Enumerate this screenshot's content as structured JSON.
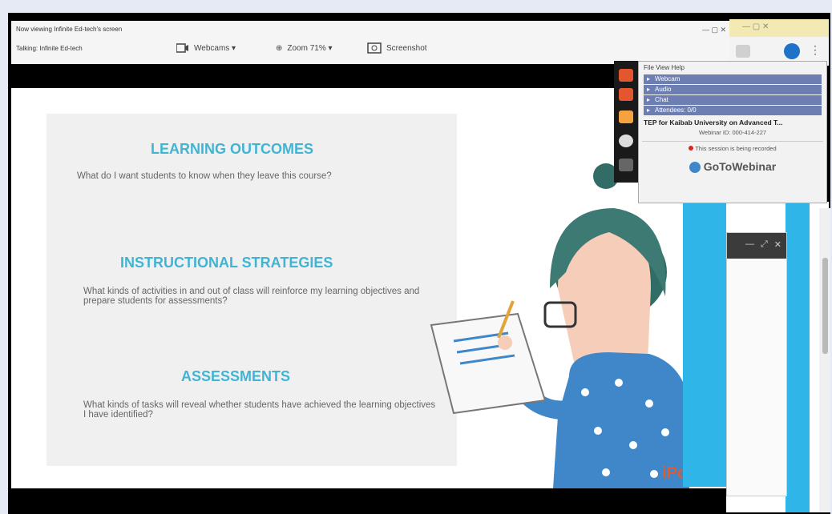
{
  "zoom_bar": {
    "viewing": "Now viewing Infinite Ed-tech's screen",
    "talking": "Talking: Infinite Ed-tech",
    "webcam": "Webcams ▾",
    "zoom": "Zoom 71% ▾",
    "screen": "Screenshot"
  },
  "slide": {
    "sections": [
      {
        "heading": "LEARNING OUTCOMES",
        "text": "What do I want students to know when they leave this course?"
      },
      {
        "heading": "INSTRUCTIONAL STRATEGIES",
        "text": "What kinds of activities in and out of class will reinforce my learning objectives and prepare students for assessments?"
      },
      {
        "heading": "ASSESSMENTS",
        "text": "What kinds of tasks will reveal whether students have achieved the learning objectives I have identified?"
      }
    ],
    "watermark": "iPods"
  },
  "gtw": {
    "menu": "File  View  Help",
    "rows": [
      "Webcam",
      "Audio",
      "Chat",
      "Attendees: 0/0"
    ],
    "title": "TEP for Kaibab University on Advanced T...",
    "id": "Webinar ID: 000-414-227",
    "rec": "This session is being recorded",
    "brand": "GoToWebinar"
  },
  "colors": {
    "accent": "#41b4d4",
    "blue": "#2fb5e8",
    "gtw": "#6d7fb2"
  }
}
